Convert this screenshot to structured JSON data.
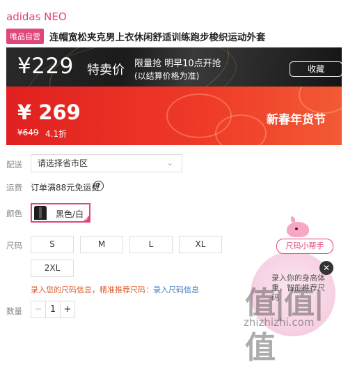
{
  "brand": "adidas NEO",
  "badge": "唯品自营",
  "title": "连帽宽松夹克男上衣休闲舒适训练跑步梭织运动外套",
  "flash": {
    "price": "¥229",
    "label": "特卖价",
    "line1": "限量抢 明早10点开抢",
    "line2": "(以结算价格为准)",
    "favorite": "收藏"
  },
  "sale": {
    "price": "¥ 269",
    "original": "¥649",
    "discount": "4.1折",
    "festival": "新春年货节"
  },
  "delivery": {
    "label": "配送",
    "placeholder": "请选择省市区"
  },
  "shipping": {
    "label": "运费",
    "text": "订单满88元免运费"
  },
  "color": {
    "label": "颜色",
    "selected": "黑色/白"
  },
  "size": {
    "label": "尺码",
    "options": [
      "S",
      "M",
      "L",
      "XL",
      "2XL"
    ],
    "tip": "录入您的尺码信息，精准推荐尺码：",
    "tip_link": "录入尺码信息"
  },
  "quantity": {
    "label": "数量",
    "value": "1",
    "minus": "−",
    "plus": "+"
  },
  "helper": {
    "pill": "尺码小帮手",
    "text": "录入你的身高体重，智能推荐尺码"
  },
  "watermark": {
    "big": "值|值|值",
    "url": "zhizhizhi.com"
  }
}
